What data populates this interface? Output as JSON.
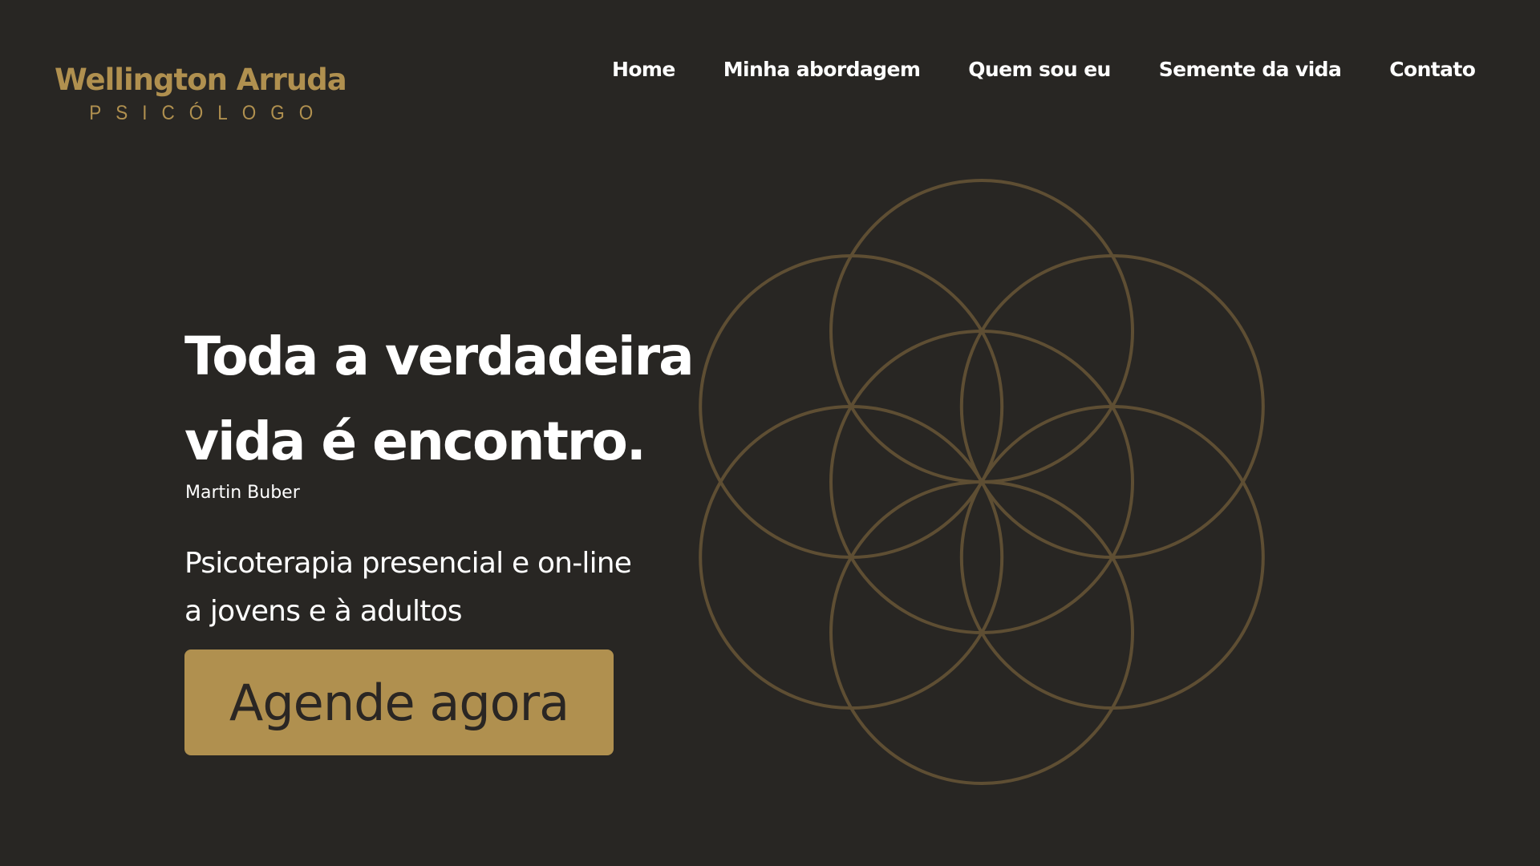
{
  "header": {
    "logo_name": "Wellington Arruda",
    "logo_subtitle": "PSICÓLOGO"
  },
  "nav": {
    "items": [
      {
        "label": "Home"
      },
      {
        "label": "Minha abordagem"
      },
      {
        "label": "Quem sou eu"
      },
      {
        "label": "Semente da vida"
      },
      {
        "label": "Contato"
      }
    ]
  },
  "hero": {
    "title_line1": "Toda a verdadeira",
    "title_line2": "vida é encontro.",
    "quote_author": "Martin Buber",
    "subtitle_line1": "Psicoterapia presencial e on-line",
    "subtitle_line2": "a jovens e à adultos",
    "cta_label": "Agende agora"
  },
  "colors": {
    "background": "#282623",
    "accent": "#B0904F",
    "flower_stroke": "#5E4E33",
    "text": "#FFFFFF"
  },
  "decoration": {
    "icon": "seed-of-life-icon"
  }
}
